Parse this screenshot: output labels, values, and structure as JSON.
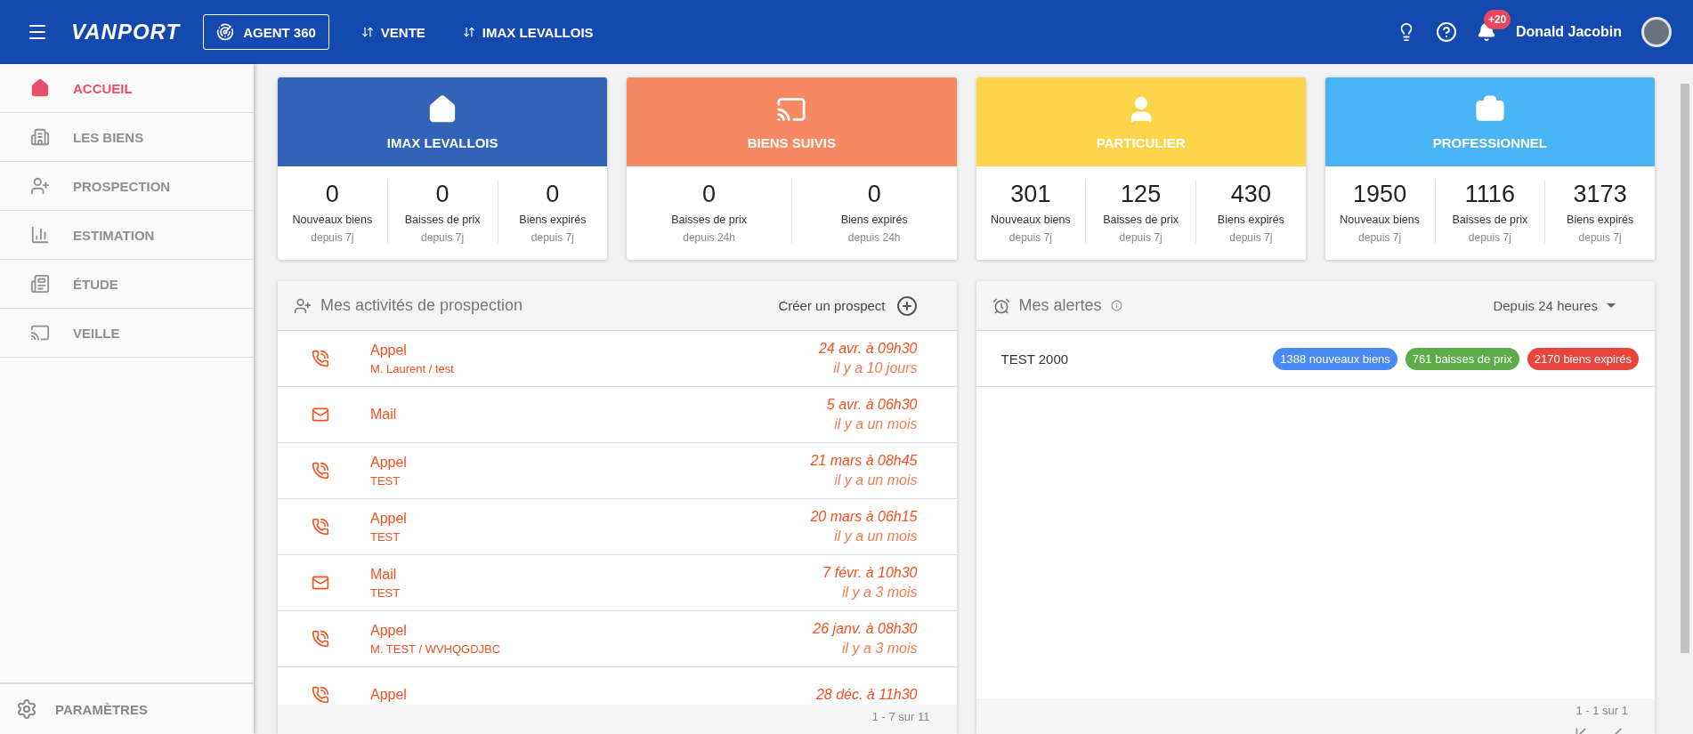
{
  "header": {
    "logo": "VANPORT",
    "agent_button": "AGENT 360",
    "nav": [
      "VENTE",
      "IMAX LEVALLOIS"
    ],
    "notification_badge": "+20",
    "user_name": "Donald Jacobin"
  },
  "sidebar": {
    "items": [
      {
        "label": "ACCUEIL",
        "selected": true
      },
      {
        "label": "LES BIENS",
        "selected": false
      },
      {
        "label": "PROSPECTION",
        "selected": false
      },
      {
        "label": "ESTIMATION",
        "selected": false
      },
      {
        "label": "ÉTUDE",
        "selected": false
      },
      {
        "label": "VEILLE",
        "selected": false
      }
    ],
    "footer": "PARAMÈTRES"
  },
  "cards": [
    {
      "title": "IMAX LEVALLOIS",
      "color": "#3263b8",
      "stats": [
        {
          "value": "0",
          "label": "Nouveaux biens",
          "sub": "depuis 7j"
        },
        {
          "value": "0",
          "label": "Baisses de prix",
          "sub": "depuis 7j"
        },
        {
          "value": "0",
          "label": "Biens expirés",
          "sub": "depuis 7j"
        }
      ]
    },
    {
      "title": "BIENS SUIVIS",
      "color": "#f78a64",
      "stats": [
        {
          "value": "0",
          "label": "Baisses de prix",
          "sub": "depuis 24h"
        },
        {
          "value": "0",
          "label": "Biens expirés",
          "sub": "depuis 24h"
        }
      ]
    },
    {
      "title": "PARTICULIER",
      "color": "#fdd44a",
      "stats": [
        {
          "value": "301",
          "label": "Nouveaux biens",
          "sub": "depuis 7j"
        },
        {
          "value": "125",
          "label": "Baisses de prix",
          "sub": "depuis 7j"
        },
        {
          "value": "430",
          "label": "Biens expirés",
          "sub": "depuis 7j"
        }
      ]
    },
    {
      "title": "PROFESSIONNEL",
      "color": "#4ab5f5",
      "stats": [
        {
          "value": "1950",
          "label": "Nouveaux biens",
          "sub": "depuis 7j"
        },
        {
          "value": "1116",
          "label": "Baisses de prix",
          "sub": "depuis 7j"
        },
        {
          "value": "3173",
          "label": "Biens expirés",
          "sub": "depuis 7j"
        }
      ]
    }
  ],
  "activities": {
    "title": "Mes activités de prospection",
    "action": "Créer un prospect",
    "rows": [
      {
        "kind": "call",
        "title": "Appel",
        "subtitle": "M. Laurent / test",
        "date": "24 avr. à 09h30",
        "ago": "il y a 10 jours"
      },
      {
        "kind": "mail",
        "title": "Mail",
        "date": "5 avr. à 06h30",
        "ago": "il y a un mois"
      },
      {
        "kind": "call",
        "title": "Appel",
        "subtitle": "TEST",
        "date": "21 mars à 08h45",
        "ago": "il y a un mois"
      },
      {
        "kind": "call",
        "title": "Appel",
        "subtitle": "TEST",
        "date": "20 mars à 06h15",
        "ago": "il y a un mois"
      },
      {
        "kind": "mail",
        "title": "Mail",
        "subtitle": "TEST",
        "date": "7 févr. à 10h30",
        "ago": "il y a 3 mois"
      },
      {
        "kind": "call",
        "title": "Appel",
        "subtitle": "M. TEST / WVHQGDJBC",
        "date": "26 janv. à 08h30",
        "ago": "il y a 3 mois"
      },
      {
        "kind": "call",
        "title": "Appel",
        "date": "28 déc. à 11h30"
      }
    ],
    "pagination": "1 - 7 sur 11"
  },
  "alerts": {
    "title": "Mes alertes",
    "filter": "Depuis 24 heures",
    "rows": [
      {
        "name": "TEST 2000",
        "tags": [
          {
            "label": "1388 nouveaux biens",
            "color": "#4a8af4"
          },
          {
            "label": "761 baisses de prix",
            "color": "#5cad4a"
          },
          {
            "label": "2170 biens expirés",
            "color": "#e8453c"
          }
        ]
      }
    ],
    "pagination": "1 - 1 sur 1"
  }
}
